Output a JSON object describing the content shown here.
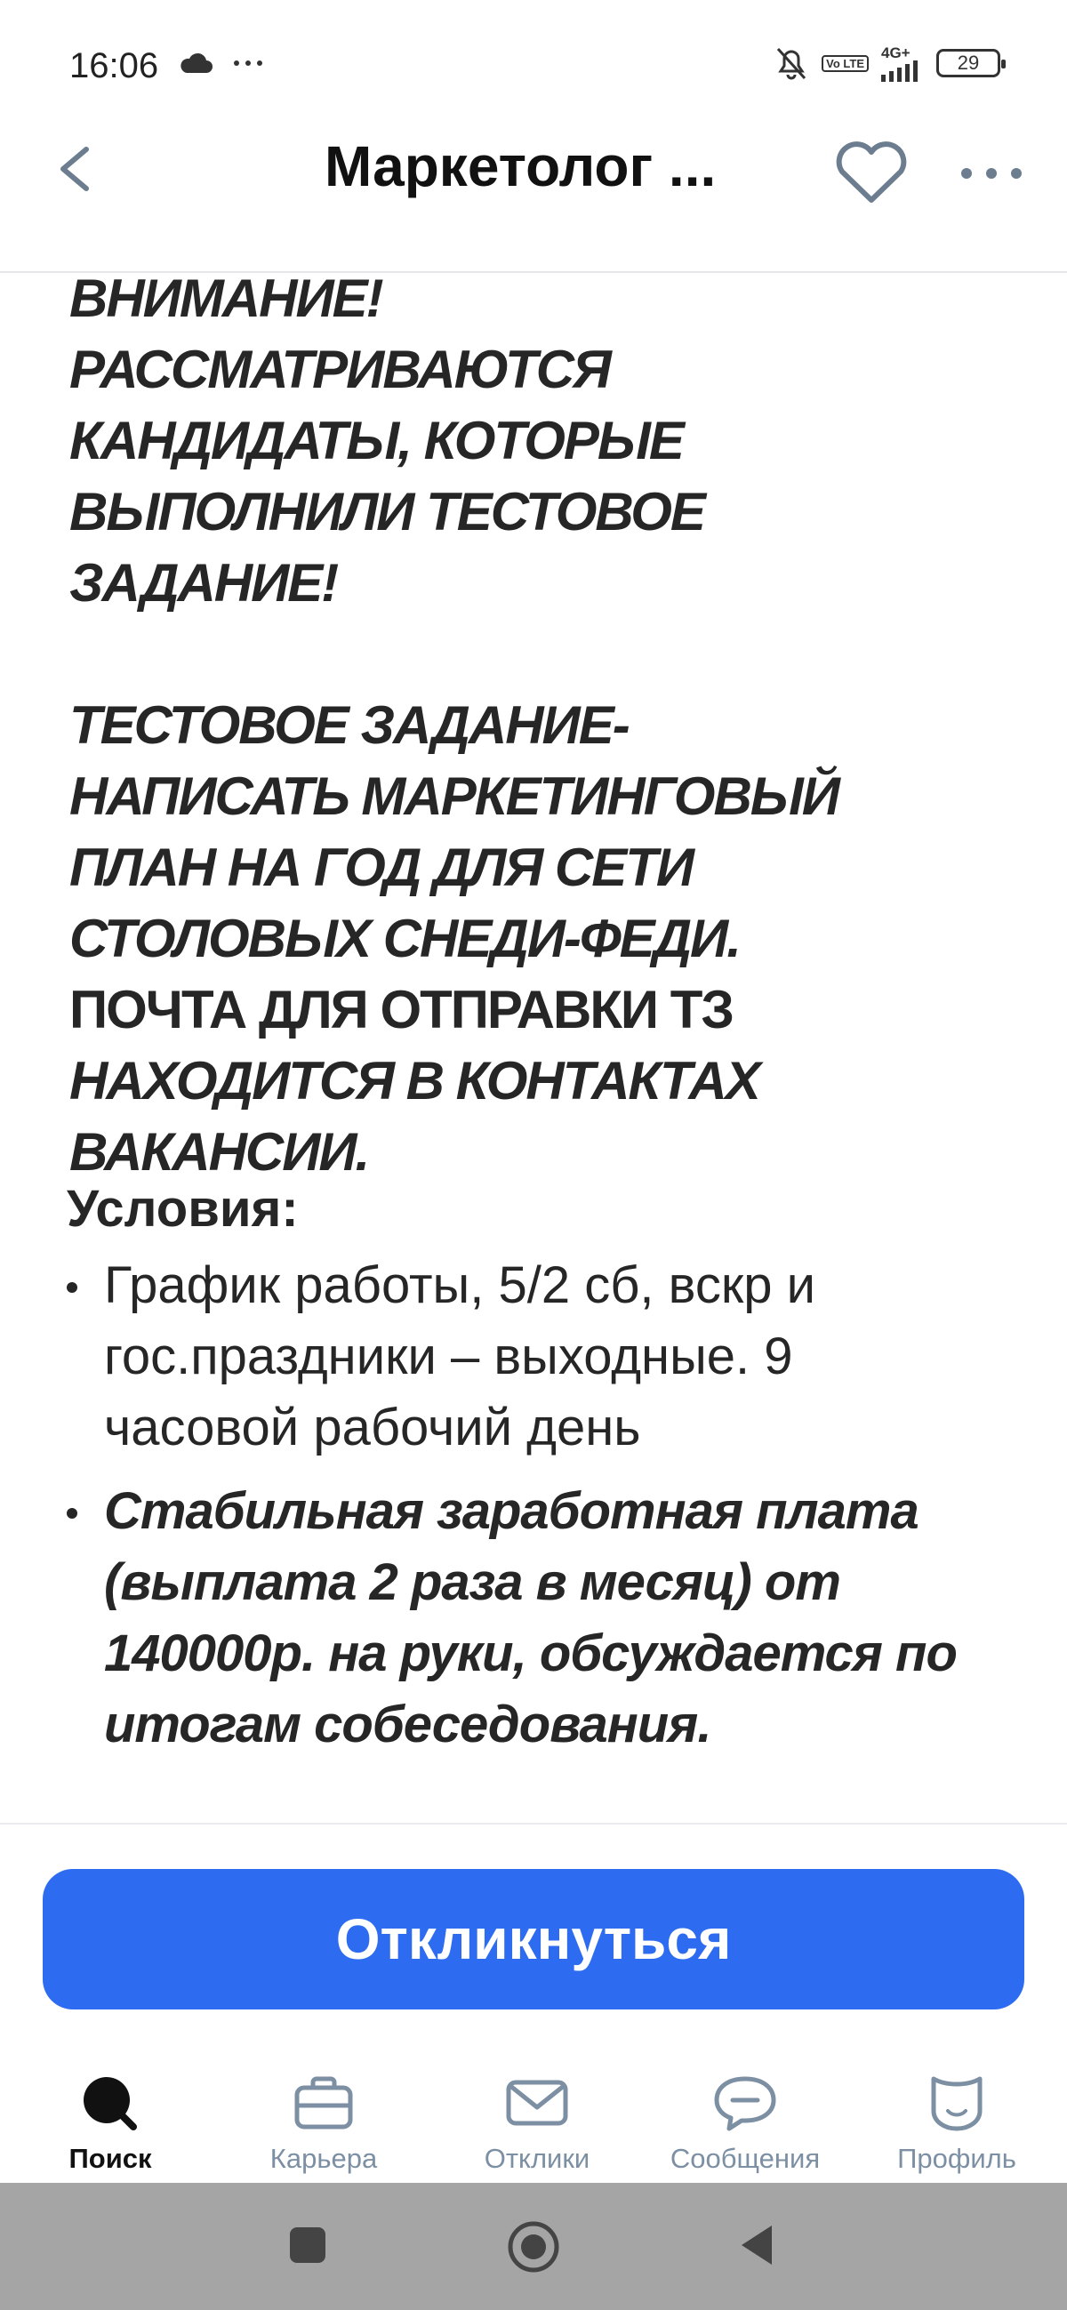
{
  "status_bar": {
    "time": "16:06",
    "network_label": "4G+",
    "volte_label": "Vo LTE",
    "battery_level": "29",
    "icons": [
      "cloud-icon",
      "more-dots-icon",
      "bell-off-icon",
      "volte-icon",
      "signal-icon",
      "battery-icon"
    ]
  },
  "header": {
    "title": "Маркетолог ...",
    "back_icon": "chevron-left-icon",
    "favorite_icon": "heart-icon",
    "more_icon": "more-horizontal-icon"
  },
  "notice": {
    "paragraph1": [
      "ВНИМАНИЕ!",
      "РАССМАТРИВАЮТСЯ",
      "КАНДИДАТЫ, КОТОРЫЕ",
      "ВЫПОЛНИЛИ ТЕСТОВОЕ",
      "ЗАДАНИЕ!"
    ],
    "paragraph2": [
      "ТЕСТОВОЕ ЗАДАНИЕ-",
      "НАПИСАТЬ МАРКЕТИНГОВЫЙ",
      "ПЛАН НА ГОД ДЛЯ СЕТИ",
      "СТОЛОВЫХ СНЕДИ-ФЕДИ.",
      "ПОЧТА ДЛЯ ОТПРАВКИ ТЗ",
      "НАХОДИТСЯ В КОНТАКТАХ",
      "ВАКАНСИИ."
    ]
  },
  "conditions": {
    "title": "Условия:",
    "items": [
      "График работы, 5/2 сб, вскр и гос.праздники – выходные. 9 часовой рабочий день",
      "Стабильная заработная плата (выплата 2 раза в месяц) от 140000р. на руки, обсуждается по итогам собеседования."
    ]
  },
  "apply_button": {
    "label": "Откликнуться",
    "color": "#2d6cf0"
  },
  "bottom_nav": {
    "items": [
      {
        "label": "Поиск",
        "icon": "search-icon",
        "active": true
      },
      {
        "label": "Карьера",
        "icon": "briefcase-icon",
        "active": false
      },
      {
        "label": "Отклики",
        "icon": "envelope-icon",
        "active": false
      },
      {
        "label": "Сообщения",
        "icon": "chat-bubble-icon",
        "active": false
      },
      {
        "label": "Профиль",
        "icon": "profile-face-icon",
        "active": false
      }
    ]
  },
  "system_nav": {
    "icons": [
      "square-recents-icon",
      "circle-home-icon",
      "triangle-back-icon"
    ]
  }
}
